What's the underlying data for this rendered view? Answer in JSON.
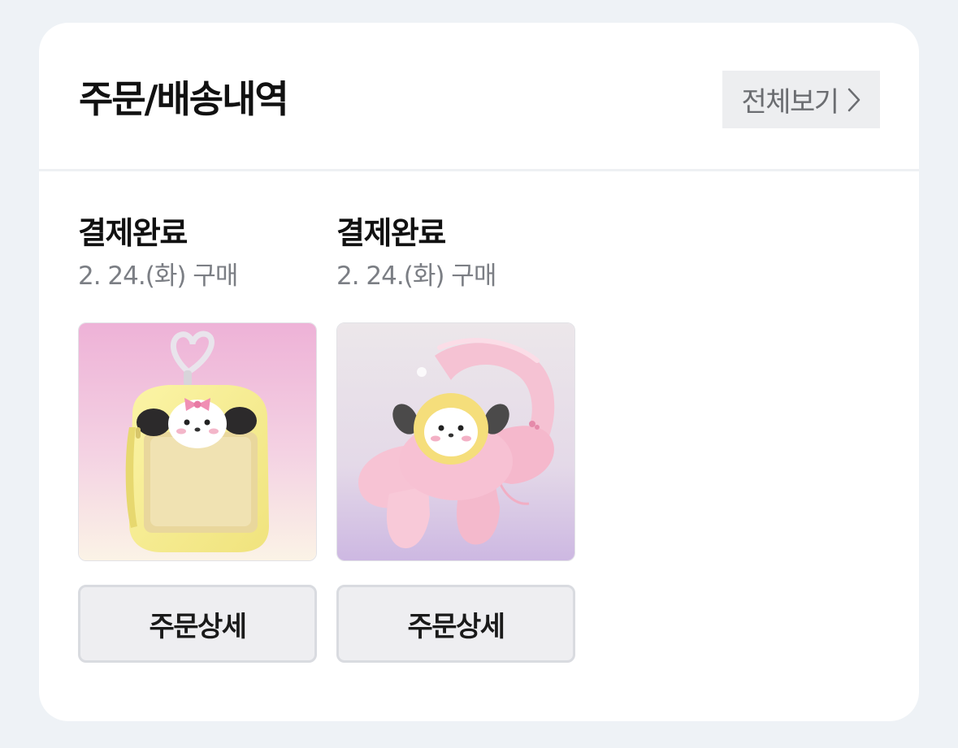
{
  "section": {
    "title": "주문/배송내역",
    "view_all_label": "전체보기"
  },
  "orders": [
    {
      "status": "결제완료",
      "date": "2. 24.(화) 구매",
      "detail_button": "주문상세",
      "product_icon": "yellow-plush-photocard-pouch-keyring"
    },
    {
      "status": "결제완료",
      "date": "2. 24.(화) 구매",
      "detail_button": "주문상세",
      "product_icon": "pink-plush-scrunchie-with-character-face"
    }
  ],
  "colors": {
    "page_background": "#eef2f6",
    "card_background": "#ffffff",
    "title_text": "#111111",
    "secondary_text": "#7b7e84",
    "button_background": "#eeeef1",
    "button_border": "#d9dbe0"
  }
}
